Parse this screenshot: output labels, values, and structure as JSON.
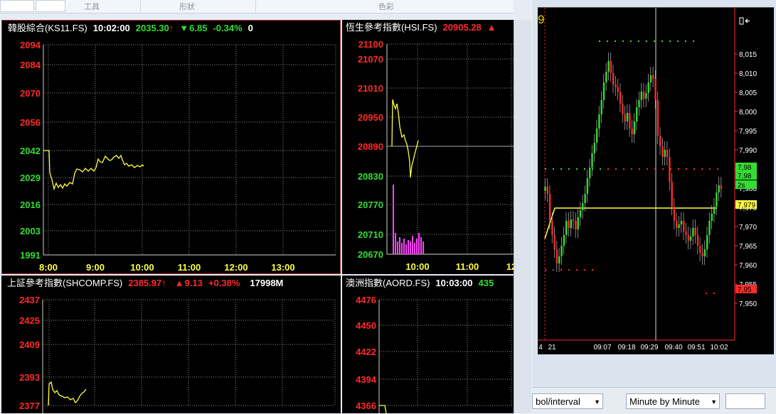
{
  "ribbon": {
    "group_tools": "工具",
    "group_shapes": "形狀",
    "group_colors": "色彩"
  },
  "panels": {
    "ks11": {
      "name": "韓股綜合(KS11.FS)",
      "time": "10:02:00",
      "price": "2035.30",
      "price_arrow": "↑",
      "change_arrow": "▼",
      "change": "6.85",
      "change_pct": "-0.34%",
      "volume": "0",
      "yticks": [
        "2094",
        "2084",
        "2070",
        "2056",
        "2042",
        "2029",
        "2016",
        "2003",
        "1991"
      ],
      "xticks": [
        "8:00",
        "9:00",
        "10:00",
        "11:00",
        "12:00",
        "13:00"
      ]
    },
    "hsi": {
      "name": "恆生參考指數(HSI.FS)",
      "price": "20905.28",
      "price_arrow": "▲",
      "yticks": [
        "21100",
        "21070",
        "21010",
        "20950",
        "20890",
        "20830",
        "20770",
        "20710",
        "20670"
      ],
      "xticks": [
        "10:00",
        "11:00",
        "12"
      ]
    },
    "shcomp": {
      "name": "上証參考指數(SHCOMP.FS)",
      "price": "2385.97",
      "price_arrow": "↑",
      "change_arrow": "▲",
      "change": "9.13",
      "change_pct": "+0.38%",
      "volume": "17998M",
      "yticks": [
        "2437",
        "2425",
        "2409",
        "2393",
        "2377"
      ]
    },
    "aord": {
      "name": "澳洲指數(AORD.FS)",
      "time": "10:03:00",
      "price": "435",
      "yticks": [
        "4476",
        "4450",
        "4422",
        "4394",
        "4366"
      ]
    }
  },
  "right_chart": {
    "corner_digit": "9",
    "corner_icon": "menu-arrow-icon",
    "yticks": [
      "8,015",
      "8,010",
      "8,005",
      "8,000",
      "7,995",
      "7,990",
      "7,985",
      "7,980",
      "7,975",
      "7,970",
      "7,965",
      "7,960",
      "7,955",
      "7,950"
    ],
    "badges": [
      "7,98",
      "7,98",
      "2s",
      "7,979",
      "7,95"
    ],
    "xticks": [
      "4",
      "21",
      "09:07",
      "09:18",
      "09:29",
      "09:40",
      "09:51",
      "10:02"
    ]
  },
  "right_toolbar": {
    "symbol_interval": "bol/interval",
    "interval_value": "Minute by Minute"
  },
  "colors": {
    "up": "#33dd33",
    "down": "#ff2a2a",
    "line": "#ffff44",
    "volume": "#ff44ff"
  }
}
